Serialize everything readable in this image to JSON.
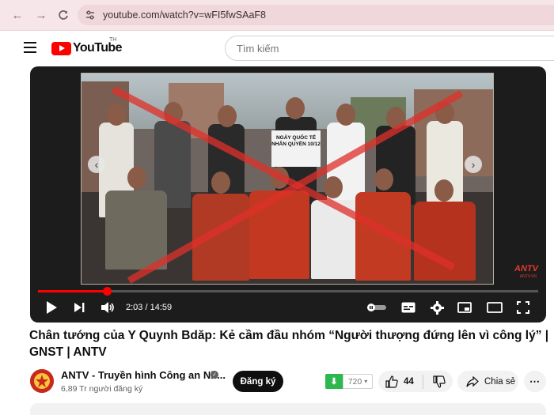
{
  "browser": {
    "url": "youtube.com/watch?v=wFI5fwSAaF8"
  },
  "header": {
    "logo_text": "YouTube",
    "country_code": "TH",
    "search_placeholder": "Tìm kiếm"
  },
  "player": {
    "sign_text": "NGÀY QUỐC TẾ NHÂN QUYỀN 10/12",
    "watermark": "ANTV",
    "watermark_sub": "ANTV.VN",
    "current_time": "2:03",
    "duration": "14:59",
    "time_label": "2:03 / 14:59",
    "progress_fraction": 0.137
  },
  "video": {
    "title": "Chân tướng của Y Quynh Bdăp: Kẻ cầm đầu nhóm “Người thượng đứng lên vì công lý” | GNST | ANTV"
  },
  "channel": {
    "name": "ANTV - Truyền hình Công an Nh...",
    "subscribers": "6,89 Tr người đăng ký",
    "subscribe_label": "Đăng ký"
  },
  "actions": {
    "download_count": "720",
    "like_count": "44",
    "share_label": "Chia sẻ"
  },
  "colors": {
    "accent": "#ff0000",
    "browser_bar": "#f7e6e9",
    "download_green": "#2db84d"
  }
}
